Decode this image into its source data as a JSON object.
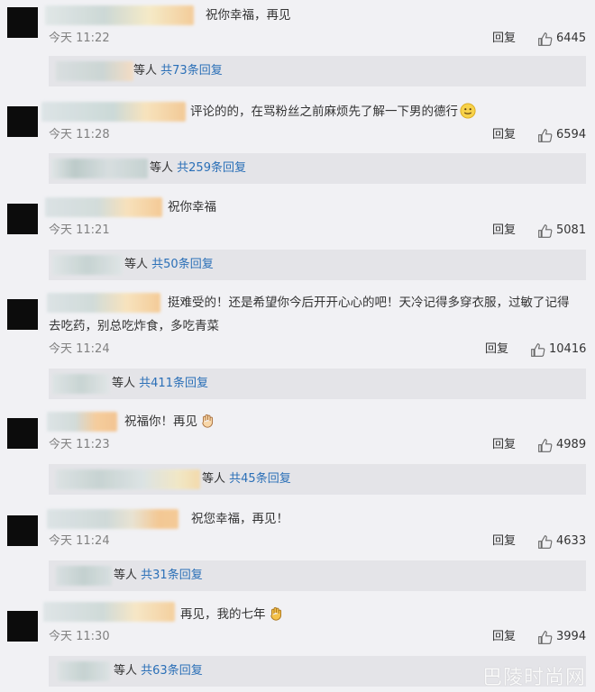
{
  "comments": [
    {
      "text": "祝你幸福，再见",
      "time": "今天 11:22",
      "reply_label": "回复",
      "likes": "6445",
      "summary": {
        "label": "等人",
        "count": "共73条回复"
      }
    },
    {
      "text": "评论的的，在骂粉丝之前麻烦先了解一下男的德行",
      "time": "今天 11:28",
      "reply_label": "回复",
      "likes": "6594",
      "emoji": "smile-emoji",
      "summary": {
        "label": "等人",
        "count": "共259条回复"
      }
    },
    {
      "text": "祝你幸福",
      "time": "今天 11:21",
      "reply_label": "回复",
      "likes": "5081",
      "summary": {
        "label": "等人",
        "count": "共50条回复"
      }
    },
    {
      "text_line1": "挺难受的！还是希望你今后开开心心的吧！天冷记得多穿衣服，过敏了记得",
      "text_line2": "去吃药，别总吃炸食，多吃青菜",
      "time": "今天 11:24",
      "reply_label": "回复",
      "likes": "10416",
      "summary": {
        "label": "等人",
        "count": "共411条回复"
      }
    },
    {
      "text": "祝福你！再见",
      "time": "今天 11:23",
      "reply_label": "回复",
      "likes": "4989",
      "emoji": "wave-hand-emoji",
      "summary": {
        "label": "等人",
        "count": "共45条回复"
      }
    },
    {
      "text": "祝您幸福，再见！",
      "time": "今天 11:24",
      "reply_label": "回复",
      "likes": "4633",
      "summary": {
        "label": "等人",
        "count": "共31条回复"
      }
    },
    {
      "text": "再见，我的七年",
      "time": "今天 11:30",
      "reply_label": "回复",
      "likes": "3994",
      "emoji": "wave-hand-emoji",
      "summary": {
        "label": "等人",
        "count": "共63条回复"
      }
    }
  ],
  "watermark": "巴陵时尚网",
  "colors": {
    "background": "#f1f1f4",
    "summary_bg": "#e4e4e8",
    "link_blue": "#2a6fb7",
    "avatar": "#0c0c0c"
  }
}
